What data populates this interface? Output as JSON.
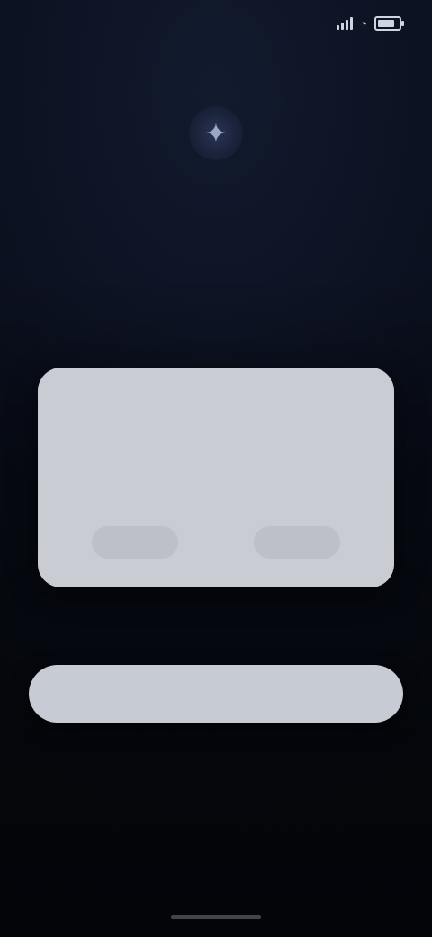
{
  "status_bar": {
    "time": "",
    "carrier": ""
  },
  "hero": {
    "icon": "sparkle-icon",
    "title": "",
    "subtitle": ""
  },
  "dialog": {
    "title": "",
    "body": "",
    "left_button": "",
    "right_button": ""
  },
  "primary_action": {
    "label": ""
  },
  "secondary_action": {
    "label": ""
  },
  "colors": {
    "background": "#0b1020",
    "dialog": "#c9ccd3",
    "primary_button": "#c7cbd3"
  }
}
